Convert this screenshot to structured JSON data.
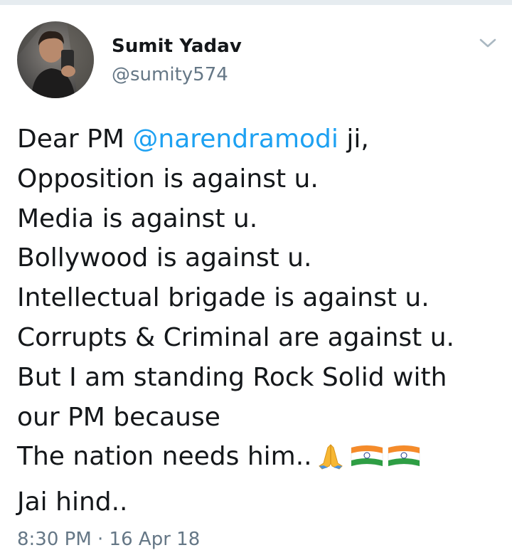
{
  "author": {
    "name": "Sumit Yadav",
    "handle": "@sumity574",
    "avatar_icon": "profile-photo"
  },
  "menu": {
    "icon": "chevron-down-icon"
  },
  "tweet": {
    "line1_prefix": "Dear PM ",
    "mention": "@narendramodi",
    "line1_suffix": " ji,",
    "lines": [
      "Opposition is against u.",
      "Media is against u.",
      "Bollywood is against u.",
      "Intellectual brigade is against u.",
      "Corrupts & Criminal are against u.",
      "But I am standing Rock Solid with",
      "our PM because"
    ],
    "line_nation": "The nation needs him..",
    "emojis": [
      "folded-hands-icon",
      "india-flag-icon",
      "india-flag-icon"
    ],
    "line_last": "Jai hind..",
    "timestamp": "8:30 PM · 16 Apr 18"
  },
  "colors": {
    "link": "#1da1f2",
    "text": "#14171a",
    "secondary": "#657786"
  }
}
